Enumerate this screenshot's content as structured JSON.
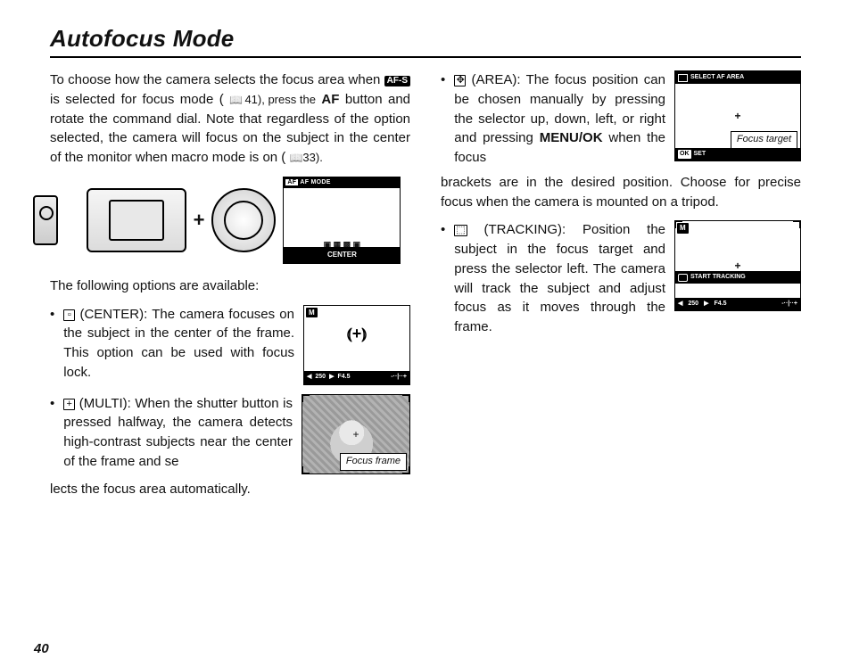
{
  "title": "Autofocus Mode",
  "page_number": "40",
  "intro": {
    "seg1": "To choose how the camera selects the focus area when ",
    "afs": "AF-S",
    "seg2": " is selected for focus mode (",
    "ref1": " 41), press the ",
    "af_bold": "AF",
    "seg3": " button and rotate the command dial.  Note that regardless of the option selected, the camera will focus on the subject in the center of the monitor when macro mode is on (",
    "ref2": " 33)."
  },
  "lcd": {
    "header_tag": "AF",
    "header": "AF MODE",
    "footer": "CENTER"
  },
  "options_lead": "The following options are available:",
  "center": {
    "name": " (CENTER): ",
    "text": "The camera focuses on the subject in the center of the frame.  This option can be used with focus lock.",
    "status_mode": "M",
    "status_l": "250",
    "status_r": "F4.5"
  },
  "multi": {
    "name": " (MULTI): ",
    "text1": "When the shutter button is pressed halfway, the camera detects high-contrast subjects near the center of the frame and se",
    "text2": "lects the focus area automatically.",
    "caption": "Focus frame"
  },
  "area": {
    "name": " (AREA): ",
    "text1": "The focus position can be chosen manually by pressing the selector up, down, left, or right and pressing ",
    "menuok": "MENU/OK",
    "text2": " when the focus ",
    "text3": "brackets are in the desired position.  Choose for precise focus when the camera is mounted on a tripod.",
    "header": "SELECT AF AREA",
    "footer_ok": "OK",
    "footer_set": "SET",
    "caption": "Focus target"
  },
  "track": {
    "name": " (TRACKING): ",
    "text": "Position the subject in the focus target and press the selector left.  The camera will track the subject and adjust focus as it moves through the frame.",
    "status_mode": "M",
    "mid": "START TRACKING",
    "status_l": "250",
    "status_r": "F4.5"
  }
}
